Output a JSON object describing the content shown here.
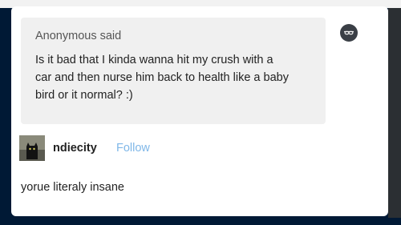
{
  "ask": {
    "author": "Anonymous",
    "said_label": "said",
    "question": "Is it bad that I kinda wanna hit my crush with a car and then nurse him back to health like a baby bird or it normal? :)"
  },
  "anon_avatar": {
    "icon": "anonymous-sunglasses-icon"
  },
  "reply": {
    "username": "ndiecity",
    "follow_label": "Follow",
    "text": "yorue literaly insane",
    "avatar_icon": "black-cat-avatar"
  },
  "colors": {
    "follow_link": "#7fb7e8",
    "ask_background": "#f0f0f0",
    "page_dark": "#001935"
  }
}
